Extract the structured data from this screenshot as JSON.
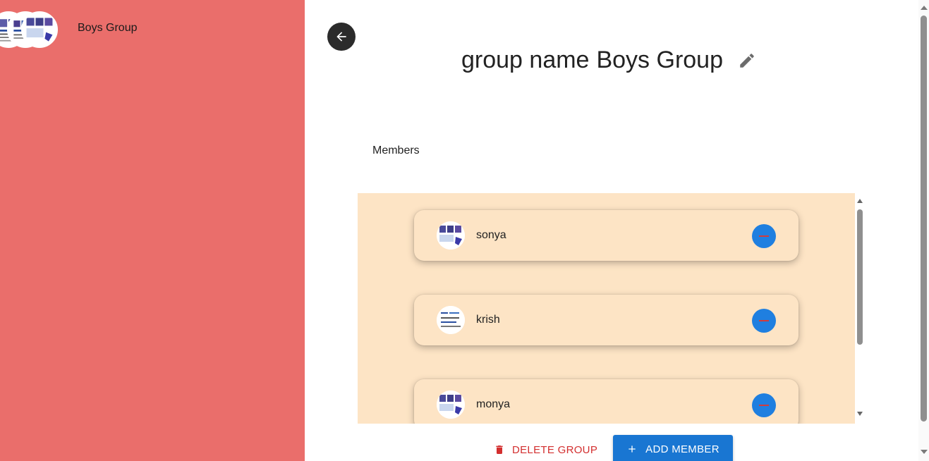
{
  "sidebar": {
    "groups": [
      {
        "name": "Boys Group"
      }
    ]
  },
  "main": {
    "title_prefix": "group name",
    "group_name": "Boys Group",
    "members_label": "Members",
    "members": [
      {
        "name": "sonya"
      },
      {
        "name": "krish"
      },
      {
        "name": "monya"
      }
    ],
    "delete_label": "DELETE GROUP",
    "add_label": "ADD MEMBER"
  },
  "colors": {
    "sidebar_bg": "#ea6e6b",
    "list_bg": "#fde4c5",
    "primary": "#1976d2",
    "danger": "#d32f2f",
    "back_button": "#2b2b2b"
  },
  "icons": [
    "arrow-left-icon",
    "pencil-icon",
    "minus-icon",
    "trash-icon",
    "plus-icon"
  ]
}
